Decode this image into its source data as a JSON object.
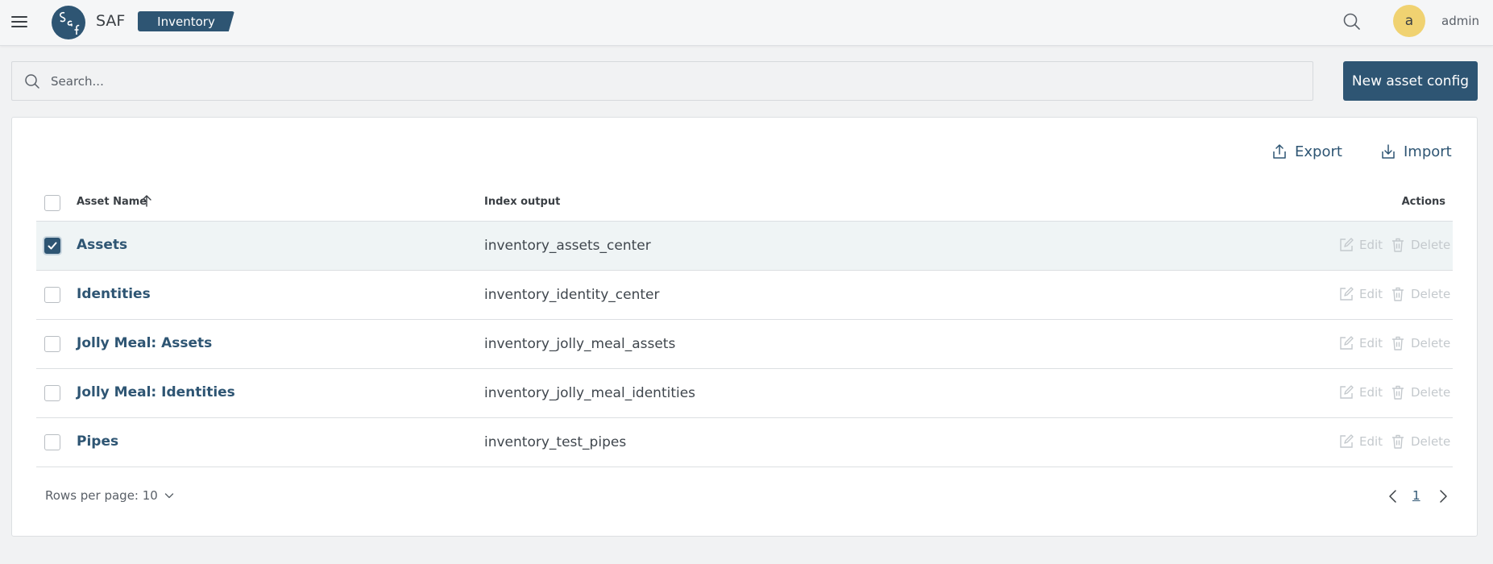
{
  "header": {
    "brand": "SAF",
    "module": "Inventory",
    "avatar_initial": "a",
    "username": "admin"
  },
  "search": {
    "placeholder": "Search...",
    "value": ""
  },
  "new_button_label": "New asset config",
  "toolbar": {
    "export_label": "Export",
    "import_label": "Import"
  },
  "table": {
    "columns": {
      "name": "Asset Name",
      "index": "Index output",
      "actions": "Actions"
    },
    "sort": {
      "column": "Asset Name",
      "direction": "ascending"
    },
    "rows": [
      {
        "name": "Assets",
        "index": "inventory_assets_center",
        "checked": true
      },
      {
        "name": "Identities",
        "index": "inventory_identity_center",
        "checked": false
      },
      {
        "name": "Jolly Meal: Assets",
        "index": "inventory_jolly_meal_assets",
        "checked": false
      },
      {
        "name": "Jolly Meal: Identities",
        "index": "inventory_jolly_meal_identities",
        "checked": false
      },
      {
        "name": "Pipes",
        "index": "inventory_test_pipes",
        "checked": false
      }
    ],
    "edit_label": "Edit",
    "delete_label": "Delete"
  },
  "pagination": {
    "rows_per_page": "Rows per page: 10",
    "current_page": "1"
  },
  "colors": {
    "primary": "#2e5573",
    "avatar": "#f0d271",
    "selected_row": "#eff4f5"
  },
  "icons": [
    "menu-icon",
    "logo",
    "search-icon",
    "user-avatar",
    "export-icon",
    "import-icon",
    "sort-ascending-icon",
    "checkbox-check-icon",
    "edit-icon",
    "delete-icon",
    "chevron-down-icon",
    "chevron-left-icon",
    "chevron-right-icon"
  ]
}
